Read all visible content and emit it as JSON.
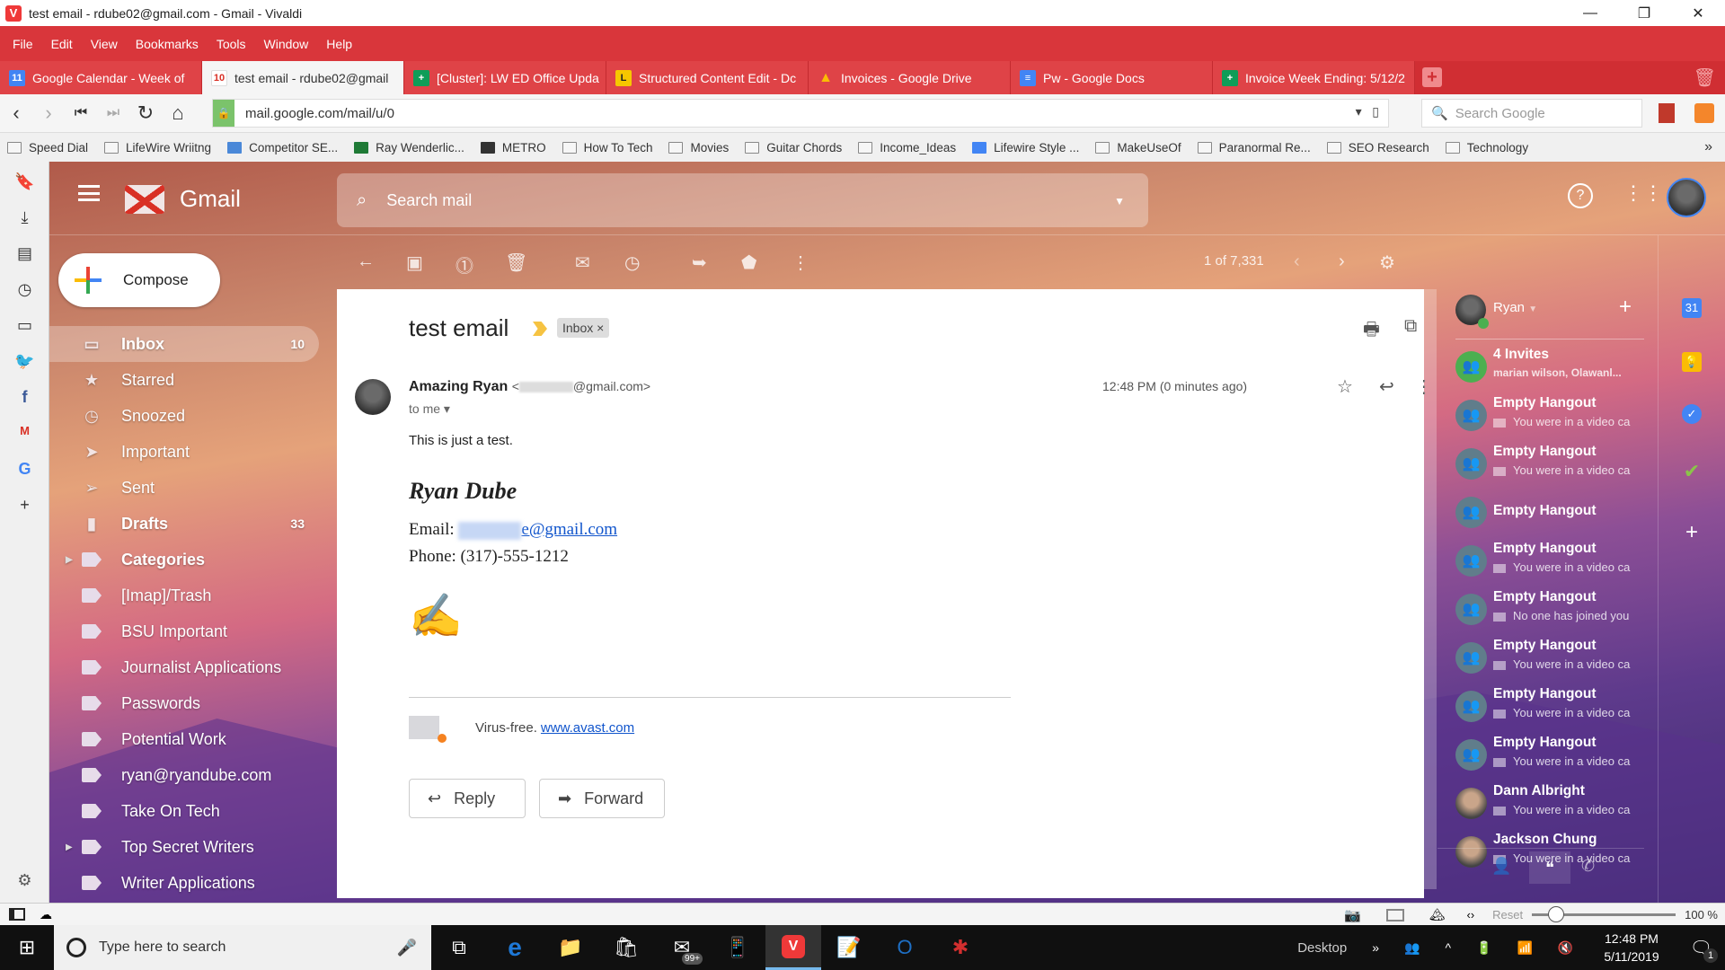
{
  "window": {
    "title": "test email - rdube02@gmail.com - Gmail - Vivaldi",
    "logo": "V"
  },
  "menu": [
    "File",
    "Edit",
    "View",
    "Bookmarks",
    "Tools",
    "Window",
    "Help"
  ],
  "tabs": [
    {
      "label": "Google Calendar - Week of",
      "icon": "calendar-icon",
      "color": "#4285f4",
      "glyph": "11"
    },
    {
      "label": "test email - rdube02@gmail",
      "icon": "gmail-icon",
      "color": "#ffffff",
      "glyph": "10",
      "active": true
    },
    {
      "label": "[Cluster]: LW ED Office Upda",
      "icon": "sheets-icon",
      "color": "#0f9d58",
      "glyph": "+"
    },
    {
      "label": "Structured Content Edit - Dc",
      "icon": "lifewire-icon",
      "color": "#f6c700",
      "glyph": "L"
    },
    {
      "label": "Invoices - Google Drive",
      "icon": "drive-icon",
      "color": "#fbbc04",
      "glyph": "▲"
    },
    {
      "label": "Pw - Google Docs",
      "icon": "docs-icon",
      "color": "#4285f4",
      "glyph": "≡"
    },
    {
      "label": "Invoice Week Ending: 5/12/2",
      "icon": "sheets-icon",
      "color": "#0f9d58",
      "glyph": "+"
    }
  ],
  "address": {
    "url": "mail.google.com/mail/u/0",
    "search_placeholder": "Search Google"
  },
  "bookmarks": [
    {
      "label": "Speed Dial",
      "icon": "folder-icon"
    },
    {
      "label": "LifeWire Wriitng",
      "icon": "folder-icon"
    },
    {
      "label": "Competitor SE...",
      "icon": "chart-icon"
    },
    {
      "label": "Ray Wenderlic...",
      "icon": "rw-icon"
    },
    {
      "label": "METRO",
      "icon": "metro-icon"
    },
    {
      "label": "How To Tech",
      "icon": "folder-icon"
    },
    {
      "label": "Movies",
      "icon": "folder-icon"
    },
    {
      "label": "Guitar Chords",
      "icon": "folder-icon"
    },
    {
      "label": "Income_Ideas",
      "icon": "folder-icon"
    },
    {
      "label": "Lifewire Style ...",
      "icon": "docs-icon"
    },
    {
      "label": "MakeUseOf",
      "icon": "folder-icon"
    },
    {
      "label": "Paranormal Re...",
      "icon": "folder-icon"
    },
    {
      "label": "SEO Research",
      "icon": "folder-icon"
    },
    {
      "label": "Technology",
      "icon": "folder-icon"
    }
  ],
  "gmail": {
    "app_name": "Gmail",
    "search_placeholder": "Search mail",
    "compose_label": "Compose",
    "pager": "1 of 7,331",
    "nav": [
      {
        "label": "Inbox",
        "count": "10",
        "icon": "inbox-icon",
        "glyph": "▭",
        "active": true
      },
      {
        "label": "Starred",
        "icon": "star-icon",
        "glyph": "★"
      },
      {
        "label": "Snoozed",
        "icon": "clock-icon",
        "glyph": "◷"
      },
      {
        "label": "Important",
        "icon": "important-icon",
        "glyph": "➤"
      },
      {
        "label": "Sent",
        "icon": "send-icon",
        "glyph": "➢"
      },
      {
        "label": "Drafts",
        "count": "33",
        "icon": "draft-icon",
        "glyph": "▮",
        "bold": true
      },
      {
        "label": "Categories",
        "icon": "label-icon",
        "bold": true,
        "expand": true
      },
      {
        "label": "[Imap]/Trash",
        "icon": "label-icon"
      },
      {
        "label": "BSU Important",
        "icon": "label-icon"
      },
      {
        "label": "Journalist Applications",
        "icon": "label-icon"
      },
      {
        "label": "Passwords",
        "icon": "label-icon"
      },
      {
        "label": "Potential Work",
        "icon": "label-icon"
      },
      {
        "label": "ryan@ryandube.com",
        "icon": "label-icon"
      },
      {
        "label": "Take On Tech",
        "icon": "label-icon"
      },
      {
        "label": "Top Secret Writers",
        "icon": "label-icon",
        "expand": true
      },
      {
        "label": "Writer Applications",
        "icon": "label-icon"
      }
    ],
    "email": {
      "subject": "test email",
      "label_chip": "Inbox ×",
      "sender_name": "Amazing Ryan",
      "sender_email_suffix": "@gmail.com>",
      "sender_email_prefix": "<",
      "to": "to me",
      "timestamp": "12:48 PM (0 minutes ago)",
      "body": "This is just a test.",
      "signature_name": "Ryan Dube",
      "sig_email_label": "Email: ",
      "sig_email_link": "e@gmail.com",
      "sig_phone": "Phone: (317)-555-1212",
      "virus_text": "Virus-free.",
      "virus_link": "www.avast.com",
      "reply_label": "Reply",
      "forward_label": "Forward"
    }
  },
  "hangouts": {
    "user": "Ryan",
    "items": [
      {
        "name": "4 Invites",
        "sub": "marian wilson, Olawanl...",
        "type": "invite"
      },
      {
        "name": "Empty Hangout",
        "sub": "You were in a video ca",
        "type": "group"
      },
      {
        "name": "Empty Hangout",
        "sub": "You were in a video ca",
        "type": "group"
      },
      {
        "name": "Empty Hangout",
        "sub": "",
        "type": "group"
      },
      {
        "name": "Empty Hangout",
        "sub": "You were in a video ca",
        "type": "group"
      },
      {
        "name": "Empty Hangout",
        "sub": "No one has joined you",
        "type": "group"
      },
      {
        "name": "Empty Hangout",
        "sub": "You were in a video ca",
        "type": "group"
      },
      {
        "name": "Empty Hangout",
        "sub": "You were in a video ca",
        "type": "group"
      },
      {
        "name": "Empty Hangout",
        "sub": "You were in a video ca",
        "type": "group"
      },
      {
        "name": "Dann Albright",
        "sub": "You were in a video ca",
        "type": "person"
      },
      {
        "name": "Jackson Chung",
        "sub": "You were in a video ca",
        "type": "person"
      }
    ]
  },
  "statusbar": {
    "reset_label": "Reset",
    "zoom": "100 %",
    "zoom_value": 100
  },
  "taskbar": {
    "search_placeholder": "Type here to search",
    "mail_badge": "99+",
    "desktop_label": "Desktop",
    "time": "12:48 PM",
    "date": "5/11/2019",
    "notifications": "1"
  }
}
